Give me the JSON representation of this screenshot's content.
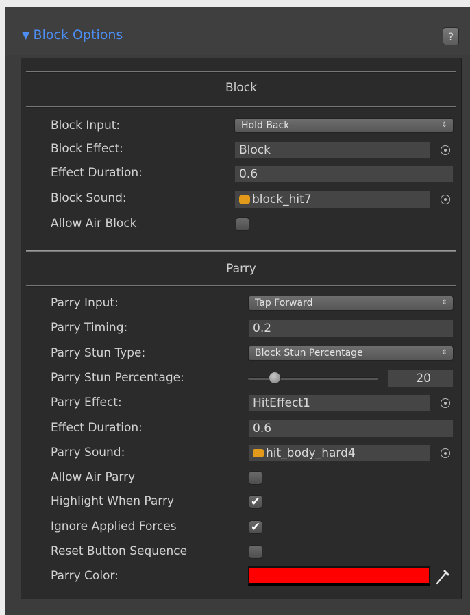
{
  "header": {
    "title": "Block Options",
    "help_label": "?"
  },
  "block_section": {
    "title": "Block",
    "block_input": {
      "label": "Block Input:",
      "value": "Hold Back"
    },
    "block_effect": {
      "label": "Block Effect:",
      "value": "Block"
    },
    "effect_duration": {
      "label": "Effect Duration:",
      "value": "0.6"
    },
    "block_sound": {
      "label": "Block Sound:",
      "value": "block_hit7"
    },
    "allow_air_block": {
      "label": "Allow Air Block",
      "checked": false
    }
  },
  "parry_section": {
    "title": "Parry",
    "parry_input": {
      "label": "Parry Input:",
      "value": "Tap Forward"
    },
    "parry_timing": {
      "label": "Parry Timing:",
      "value": "0.2"
    },
    "parry_stun_type": {
      "label": "Parry Stun Type:",
      "value": "Block Stun Percentage"
    },
    "parry_stun_percentage": {
      "label": "Parry Stun Percentage:",
      "value": "20",
      "slider_fraction": 0.2
    },
    "parry_effect": {
      "label": "Parry Effect:",
      "value": "HitEffect1"
    },
    "effect_duration": {
      "label": "Effect Duration:",
      "value": "0.6"
    },
    "parry_sound": {
      "label": "Parry Sound:",
      "value": "hit_body_hard4"
    },
    "allow_air_parry": {
      "label": "Allow Air Parry",
      "checked": false
    },
    "highlight_when_parry": {
      "label": "Highlight When Parry",
      "checked": true
    },
    "ignore_applied_forces": {
      "label": "Ignore Applied Forces",
      "checked": true
    },
    "reset_button_sequence": {
      "label": "Reset Button Sequence",
      "checked": false
    },
    "parry_color": {
      "label": "Parry Color:",
      "value": "#ff0000"
    }
  },
  "icons": {
    "checkmark": "✔",
    "popup_arrows": "⇕",
    "foldout": "▼"
  }
}
